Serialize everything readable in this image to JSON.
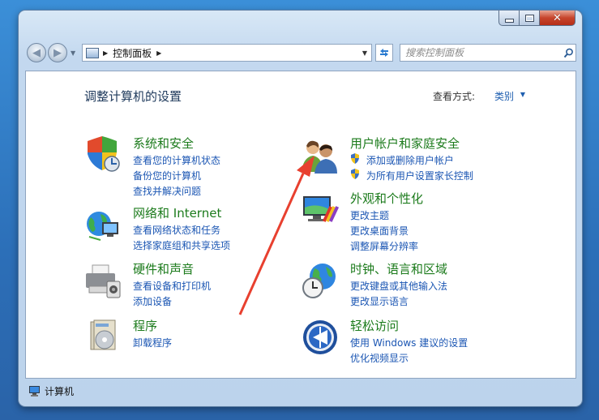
{
  "breadcrumb": {
    "current": "控制面板"
  },
  "search": {
    "placeholder": "搜索控制面板"
  },
  "main": {
    "title": "调整计算机的设置",
    "view_by_label": "查看方式:",
    "view_by_value": "类别"
  },
  "categories": [
    {
      "title": "系统和安全",
      "icon": "shield-icon",
      "links": [
        "查看您的计算机状态",
        "备份您的计算机",
        "查找并解决问题"
      ]
    },
    {
      "title": "网络和 Internet",
      "icon": "network-globe-icon",
      "links": [
        "查看网络状态和任务",
        "选择家庭组和共享选项"
      ]
    },
    {
      "title": "硬件和声音",
      "icon": "printer-icon",
      "links": [
        "查看设备和打印机",
        "添加设备"
      ]
    },
    {
      "title": "程序",
      "icon": "programs-icon",
      "links": [
        "卸载程序"
      ]
    },
    {
      "title": "用户帐户和家庭安全",
      "icon": "users-icon",
      "links": [
        "添加或删除用户帐户",
        "为所有用户设置家长控制"
      ]
    },
    {
      "title": "外观和个性化",
      "icon": "appearance-icon",
      "links": [
        "更改主题",
        "更改桌面背景",
        "调整屏幕分辨率"
      ]
    },
    {
      "title": "时钟、语言和区域",
      "icon": "clock-globe-icon",
      "links": [
        "更改键盘或其他输入法",
        "更改显示语言"
      ]
    },
    {
      "title": "轻松访问",
      "icon": "ease-of-access-icon",
      "links": [
        "使用 Windows 建议的设置",
        "优化视频显示"
      ]
    }
  ],
  "statusbar": {
    "text": "计算机"
  },
  "colors": {
    "category_title": "#1c7b1c",
    "link": "#1b56b3",
    "annotation_arrow": "#e8402f"
  }
}
